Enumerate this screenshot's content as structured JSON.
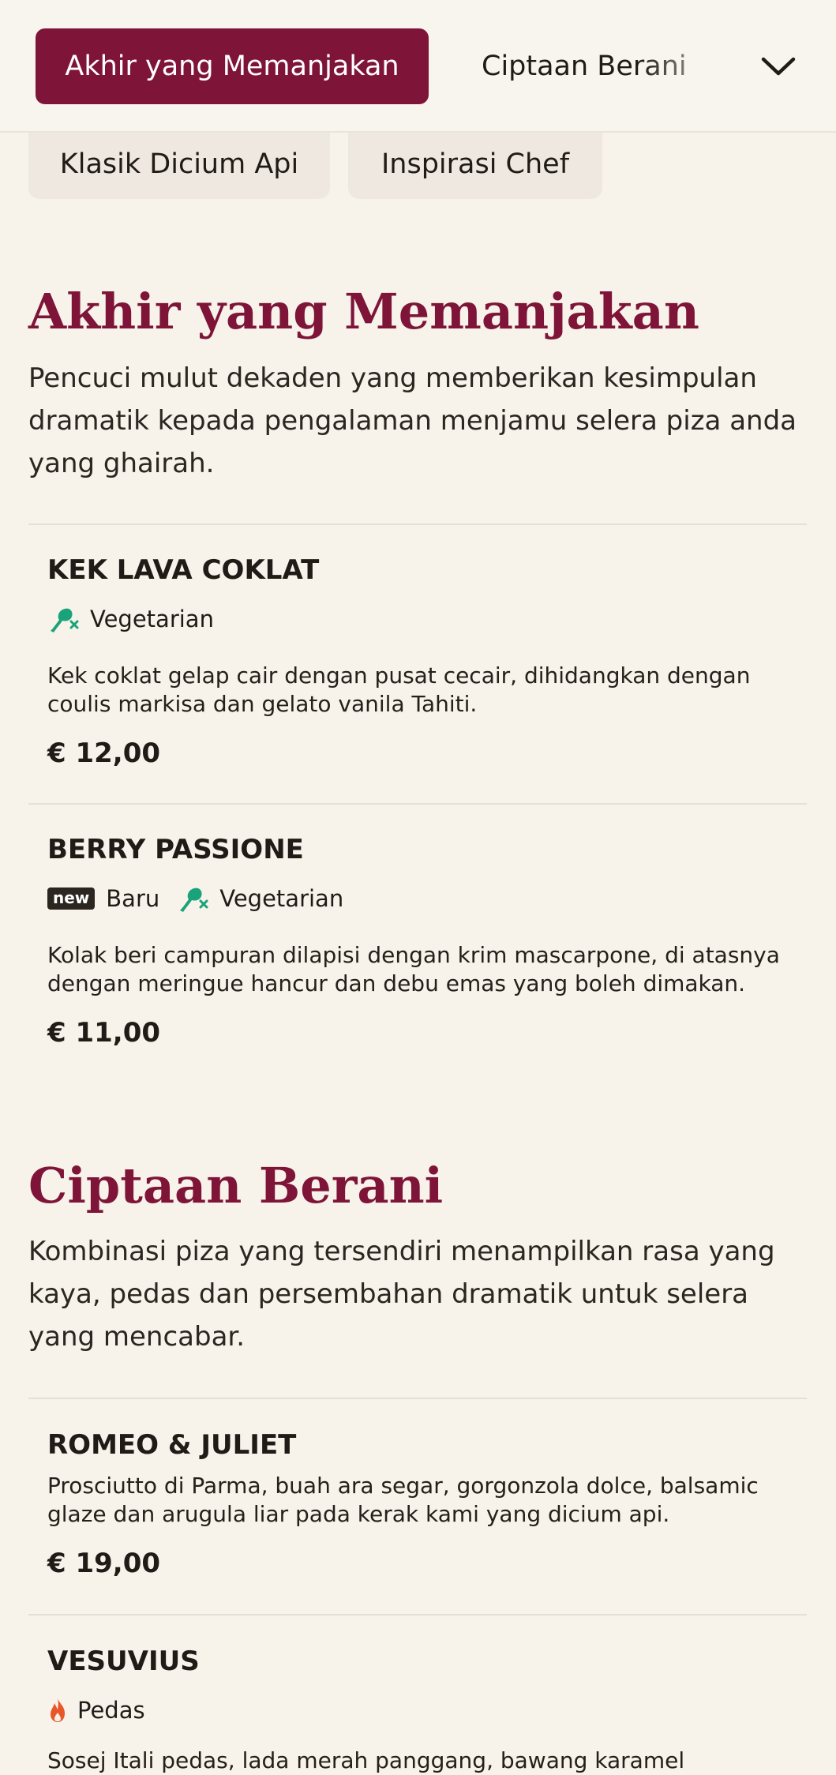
{
  "nav": {
    "tabs": [
      {
        "label": "Akhir yang Memanjakan",
        "active": true
      },
      {
        "label": "Ciptaan Berani",
        "active": false
      },
      {
        "label": "Klasik Dicium Api",
        "active": false
      },
      {
        "label": "Inspirasi Chef",
        "active": false
      }
    ],
    "expand_icon": "chevron-down-icon"
  },
  "colors": {
    "accent": "#7e1438",
    "vegetarian": "#1aa37a",
    "spicy": "#e8572a",
    "background": "#f7f2ea"
  },
  "sections": [
    {
      "title": "Akhir yang Memanjakan",
      "description": "Pencuci mulut dekaden yang memberikan kesimpulan dramatik kepada pengalaman menjamu selera piza anda yang ghairah.",
      "items": [
        {
          "name": "KEK LAVA COKLAT",
          "tags": [
            {
              "label": "Vegetarian",
              "icon": "vegetarian-icon"
            }
          ],
          "description": "Kek coklat gelap cair dengan pusat cecair, dihidangkan dengan coulis markisa dan gelato vanila Tahiti.",
          "price": "€ 12,00"
        },
        {
          "name": "BERRY PASSIONE",
          "tags": [
            {
              "label": "Baru",
              "icon": "new-badge-icon",
              "badge_text": "new"
            },
            {
              "label": "Vegetarian",
              "icon": "vegetarian-icon"
            }
          ],
          "description": "Kolak beri campuran dilapisi dengan krim mascarpone, di atasnya dengan meringue hancur dan debu emas yang boleh dimakan.",
          "price": "€ 11,00"
        }
      ]
    },
    {
      "title": "Ciptaan Berani",
      "description": "Kombinasi piza yang tersendiri menampilkan rasa yang kaya, pedas dan persembahan dramatik untuk selera yang mencabar.",
      "items": [
        {
          "name": "ROMEO & JULIET",
          "tags": [],
          "description": "Prosciutto di Parma, buah ara segar, gorgonzola dolce, balsamic glaze dan arugula liar pada kerak kami yang dicium api.",
          "price": "€ 19,00"
        },
        {
          "name": "VESUVIUS",
          "tags": [
            {
              "label": "Pedas",
              "icon": "flame-icon"
            }
          ],
          "description": "Sosej Itali pedas, lada merah panggang, bawang karamel",
          "price": ""
        }
      ]
    }
  ]
}
